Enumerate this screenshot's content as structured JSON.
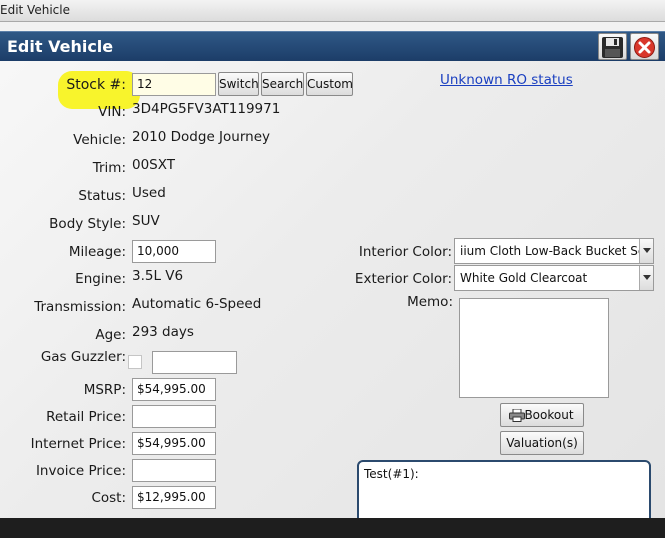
{
  "outer_window": {
    "title": "Edit Vehicle"
  },
  "header": {
    "title": "Edit Vehicle",
    "save_icon": "floppy-disk-icon",
    "close_icon": "close-icon",
    "accent": "#1c3d68",
    "close_color": "#d9372b"
  },
  "stock": {
    "label": "Stock #:",
    "value": "12",
    "highlight_color": "#f7f31a",
    "buttons": {
      "switch": "Switch",
      "search": "Search",
      "custom": "Custom"
    }
  },
  "ro_status_link": "Unknown RO status",
  "fields": {
    "vin": {
      "label": "VIN:",
      "value": "3D4PG5FV3AT119971"
    },
    "vehicle": {
      "label": "Vehicle:",
      "value": "2010 Dodge Journey"
    },
    "trim": {
      "label": "Trim:",
      "value": "00SXT"
    },
    "status": {
      "label": "Status:",
      "value": "Used"
    },
    "body_style": {
      "label": "Body Style:",
      "value": "SUV"
    },
    "mileage": {
      "label": "Mileage:",
      "value": "10,000"
    },
    "engine": {
      "label": "Engine:",
      "value": "3.5L V6"
    },
    "transmission": {
      "label": "Transmission:",
      "value": "Automatic 6-Speed"
    },
    "age": {
      "label": "Age:",
      "value": "293 days"
    },
    "gas_guzzler": {
      "label": "Gas Guzzler:",
      "value": ""
    },
    "msrp": {
      "label": "MSRP:",
      "value": "$54,995.00"
    },
    "retail_price": {
      "label": "Retail Price:",
      "value": ""
    },
    "internet_price": {
      "label": "Internet Price:",
      "value": "$54,995.00"
    },
    "invoice_price": {
      "label": "Invoice Price:",
      "value": ""
    },
    "cost": {
      "label": "Cost:",
      "value": "$12,995.00"
    }
  },
  "right": {
    "interior_color": {
      "label": "Interior Color:",
      "value": "iium Cloth Low-Back Bucket Se"
    },
    "exterior_color": {
      "label": "Exterior Color:",
      "value": "White Gold Clearcoat"
    },
    "memo": {
      "label": "Memo:",
      "value": ""
    },
    "bookout_button": {
      "label": "Bookout",
      "icon": "printer-icon"
    },
    "valuations_button": "Valuation(s)",
    "test_panel": "Test(#1):"
  }
}
